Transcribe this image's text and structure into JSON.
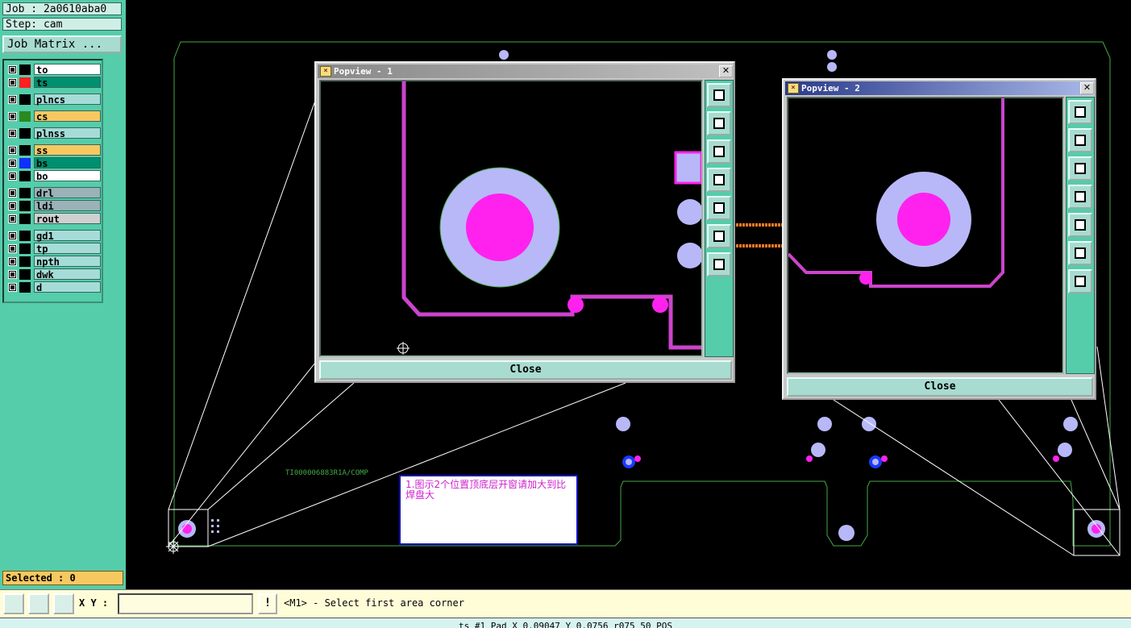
{
  "job": {
    "label": "Job : 2a0610aba0",
    "step": "Step: cam",
    "matrix_button": "Job Matrix ..."
  },
  "layers": [
    {
      "name": "to",
      "bg": "#ffffff",
      "swatch": "#000000"
    },
    {
      "name": "ts",
      "bg": "#008f6f",
      "swatch": "#ff2020",
      "active": true
    },
    {
      "name": "plncs",
      "bg": "#a6dcd8",
      "swatch": "#000000"
    },
    {
      "name": "cs",
      "bg": "#f8c860",
      "swatch": "#2a8a20"
    },
    {
      "name": "plnss",
      "bg": "#a6dcd8",
      "swatch": "#000000"
    },
    {
      "name": "ss",
      "bg": "#f8c860",
      "swatch": "#000000"
    },
    {
      "name": "bs",
      "bg": "#008f6f",
      "swatch": "#1030ff"
    },
    {
      "name": "bo",
      "bg": "#ffffff",
      "swatch": "#000000"
    },
    {
      "name": "drl",
      "bg": "#9ab2b8",
      "swatch": "#000000"
    },
    {
      "name": "ldi",
      "bg": "#9ab2b8",
      "swatch": "#000000"
    },
    {
      "name": "rout",
      "bg": "#d0d0d0",
      "swatch": "#000000"
    },
    {
      "name": "gd1",
      "bg": "#a6dcd8",
      "swatch": "#000000"
    },
    {
      "name": "tp",
      "bg": "#a6dcd8",
      "swatch": "#000000"
    },
    {
      "name": "npth",
      "bg": "#a6dcd8",
      "swatch": "#000000"
    },
    {
      "name": "dwk",
      "bg": "#a6dcd8",
      "swatch": "#000000"
    },
    {
      "name": "d",
      "bg": "#a6dcd8",
      "swatch": "#000000"
    }
  ],
  "selected": "Selected : 0",
  "toolbar": {
    "xy_label": "X Y :",
    "xy_value": "",
    "excl": "!",
    "prompt": "<M1> - Select first area corner"
  },
  "status": "ts #1 Pad X 0.09047 Y 0.0756 r075 50 POS",
  "popview1": {
    "title": "Popview - 1",
    "close": "Close",
    "title_bg": "#888888"
  },
  "popview2": {
    "title": "Popview - 2",
    "close": "Close",
    "title_bg": "#2a3a8a"
  },
  "board": {
    "text": "TI000006883R1A/COMP",
    "note": "1.图示2个位置顶底层开窗请加大到比焊盘大"
  },
  "colors": {
    "panel": "#55ccaa",
    "pad_outer": "#b8b8f8",
    "pad_inner": "#ff22ee",
    "trace": "#cc44cc",
    "outline": "#44aa44"
  }
}
